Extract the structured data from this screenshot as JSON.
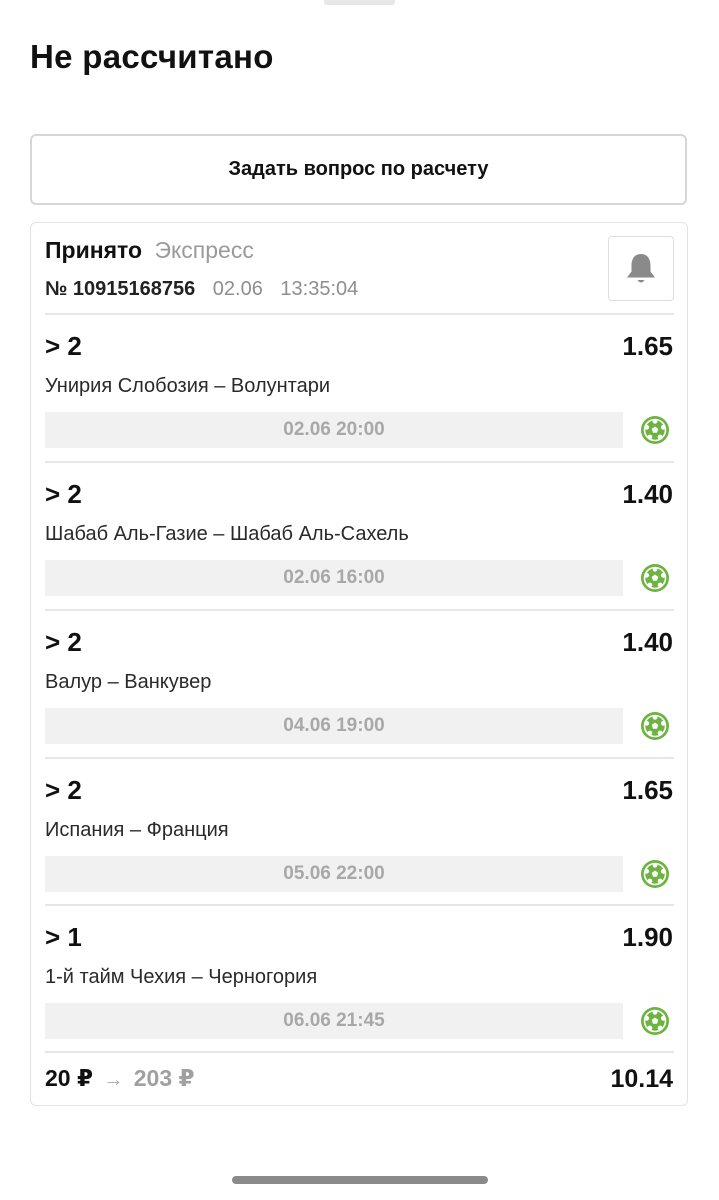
{
  "header": {
    "title": "Не рассчитано"
  },
  "actions": {
    "ask_label": "Задать вопрос по расчету"
  },
  "bet": {
    "status": "Принято",
    "type": "Экспресс",
    "number": "№ 10915168756",
    "date": "02.06",
    "time": "13:35:04",
    "bell_icon": "bell-icon",
    "selections": [
      {
        "outcome": "> 2",
        "odds": "1.65",
        "event": "Унирия Слобозия – Волунтари",
        "start": "02.06 20:00",
        "sport_icon": "football-icon"
      },
      {
        "outcome": "> 2",
        "odds": "1.40",
        "event": "Шабаб Аль-Газие – Шабаб Аль-Сахель",
        "start": "02.06 16:00",
        "sport_icon": "football-icon"
      },
      {
        "outcome": "> 2",
        "odds": "1.40",
        "event": "Валур – Ванкувер",
        "start": "04.06 19:00",
        "sport_icon": "football-icon"
      },
      {
        "outcome": "> 2",
        "odds": "1.65",
        "event": "Испания – Франция",
        "start": "05.06 22:00",
        "sport_icon": "football-icon"
      },
      {
        "outcome": "> 1",
        "odds": "1.90",
        "event": "1-й тайм Чехия – Черногория",
        "start": "06.06 21:45",
        "sport_icon": "football-icon"
      }
    ],
    "stake": "20 ₽",
    "arrow": "→",
    "payout": "203 ₽",
    "total_odds": "10.14"
  },
  "colors": {
    "sport_icon": "#6cb33f",
    "muted_text": "#9a9a9a",
    "date_bar": "#f1f1f1"
  }
}
